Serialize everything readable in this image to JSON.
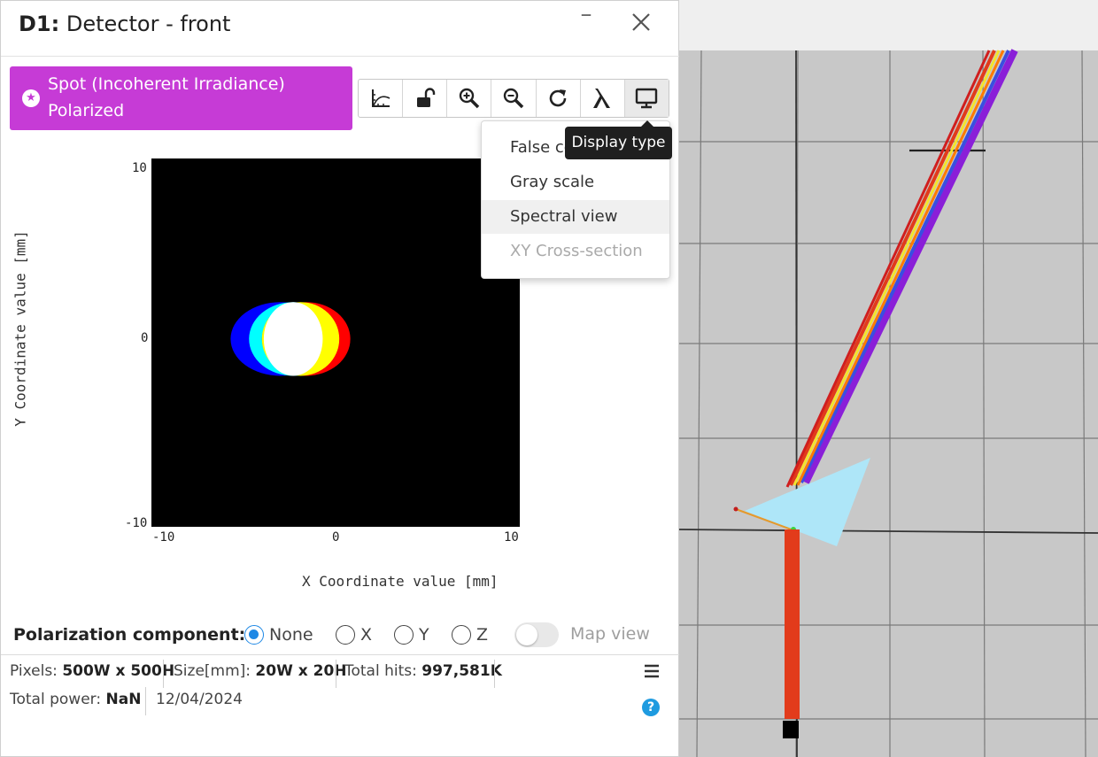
{
  "window": {
    "title_bold": "D1:",
    "title_rest": "Detector - front"
  },
  "badge": {
    "line1": "Spot (Incoherent Irradiance)",
    "line2": "Polarized",
    "color": "#c63bd6"
  },
  "toolbar": {
    "buttons": [
      "axes-icon",
      "unlock-icon",
      "zoom-in-icon",
      "zoom-out-icon",
      "refresh-icon",
      "lambda-icon",
      "monitor-icon"
    ]
  },
  "chart_data": {
    "type": "heatmap",
    "xlabel": "X Coordinate value [mm]",
    "ylabel": "Y Coordinate value [mm]",
    "xlim": [
      -10,
      10
    ],
    "ylim": [
      -10,
      10
    ],
    "x_ticks": [
      "-10",
      "0",
      "10"
    ],
    "y_ticks": [
      "10",
      "0",
      "-10"
    ],
    "background": "#000000",
    "spots": [
      {
        "color": "#0000ff",
        "center_x": -3.0,
        "center_y": 0.2,
        "radius_x": 2.7,
        "radius_y": 2.0
      },
      {
        "color": "#00ffff",
        "center_x": -2.3,
        "center_y": 0.2,
        "radius_x": 2.4,
        "radius_y": 2.0
      },
      {
        "color": "#ff0000",
        "center_x": -1.6,
        "center_y": 0.2,
        "radius_x": 2.4,
        "radius_y": 2.0
      },
      {
        "color": "#ffff00",
        "center_x": -1.9,
        "center_y": 0.2,
        "radius_x": 2.1,
        "radius_y": 2.0
      },
      {
        "color": "#ffffff",
        "center_x": -2.3,
        "center_y": 0.2,
        "radius_x": 1.6,
        "radius_y": 2.0
      }
    ]
  },
  "dropdown": {
    "items": [
      {
        "label": "False color",
        "state": "normal"
      },
      {
        "label": "Gray scale",
        "state": "normal"
      },
      {
        "label": "Spectral view",
        "state": "hover"
      },
      {
        "label": "XY Cross-section",
        "state": "disabled"
      }
    ]
  },
  "tooltip": {
    "text": "Display type"
  },
  "polarization": {
    "label": "Polarization component:",
    "options": [
      {
        "label": "None",
        "selected": true
      },
      {
        "label": "X",
        "selected": false
      },
      {
        "label": "Y",
        "selected": false
      },
      {
        "label": "Z",
        "selected": false
      }
    ],
    "map_view_label": "Map view",
    "map_view_on": false
  },
  "info": {
    "pixels_label": "Pixels:",
    "pixels_value": "500W x 500H",
    "size_label": "Size[mm]:",
    "size_value": "20W x 20H",
    "hits_label": "Total hits:",
    "hits_value": "997,581K",
    "power_label": "Total power:",
    "power_value": "NaN",
    "date": "12/04/2024"
  },
  "colors": {
    "accent_blue": "#1e88e5",
    "scene_background": "#c8c8c8",
    "prism": "#aee6f8",
    "beam_red": "#e23b1b"
  }
}
